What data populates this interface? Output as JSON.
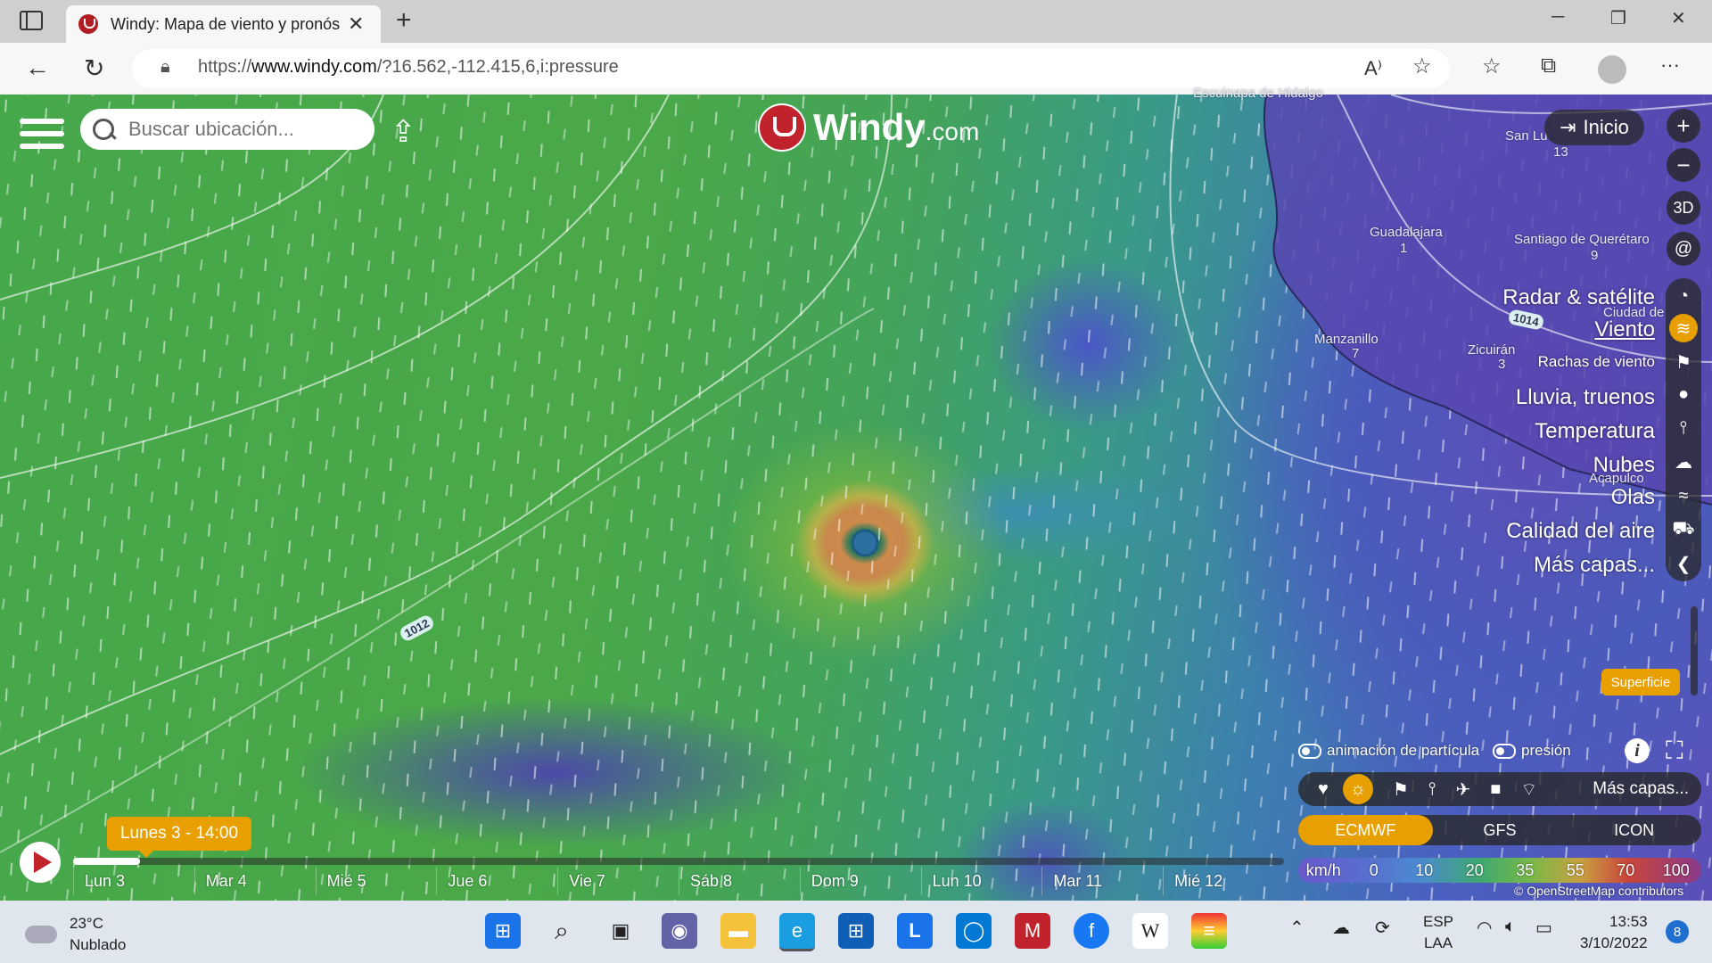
{
  "browser": {
    "tab_title": "Windy: Mapa de viento y pronós",
    "url_prefix": "https://",
    "url_host": "www.windy.com",
    "url_path": "/?16.562,-112.415,6,i:pressure"
  },
  "map": {
    "search_placeholder": "Buscar ubicación...",
    "logo_word": "Windy",
    "logo_suffix": ".com",
    "home_button": "Inicio",
    "btn_3d": "3D",
    "cities": [
      {
        "name": "Guadalajara",
        "num": "1"
      },
      {
        "name": "Santiago de Querétaro",
        "num": "9"
      },
      {
        "name": "San Lu",
        "num": "13"
      },
      {
        "name": "Manzanillo",
        "num": "7"
      },
      {
        "name": "Zicuirán",
        "num": "3"
      },
      {
        "name": "Ciudad de",
        "num": ""
      },
      {
        "name": "Acapulco",
        "num": ""
      },
      {
        "name": "Escuinapa de Hidalgo",
        "num": ""
      }
    ],
    "isobars": [
      "1014",
      "1012"
    ],
    "layers": [
      {
        "label": "Radar & satélite",
        "icon": "radar-icon"
      },
      {
        "label": "Viento",
        "icon": "wind-icon",
        "selected": true
      },
      {
        "label": "Rachas de viento",
        "icon": "gust-flag-icon"
      },
      {
        "label": "Lluvia, truenos",
        "icon": "rain-drop-icon"
      },
      {
        "label": "Temperatura",
        "icon": "thermometer-icon"
      },
      {
        "label": "Nubes",
        "icon": "cloud-icon"
      },
      {
        "label": "Olas",
        "icon": "waves-icon"
      },
      {
        "label": "Calidad del aire",
        "icon": "car-icon"
      },
      {
        "label": "Más capas...",
        "icon": "chevron-left-icon"
      }
    ],
    "altitude": "Superficie",
    "toggles": {
      "particles": "animación de partícula",
      "pressure": "presión"
    },
    "quick_more": "Más capas...",
    "models": [
      "ECMWF",
      "GFS",
      "ICON"
    ],
    "selected_model": "ECMWF",
    "legend_unit": "km/h",
    "legend_values": [
      "0",
      "10",
      "20",
      "35",
      "55",
      "70",
      "100"
    ],
    "attribution": "© OpenStreetMap contributors",
    "timeline": {
      "current": "Lunes 3 - 14:00",
      "progress": 0.055,
      "days": [
        "Lun 3",
        "Mar 4",
        "Mié 5",
        "Jue 6",
        "Vie 7",
        "Sáb 8",
        "Dom 9",
        "Lun 10",
        "Mar 11",
        "Mié 12"
      ]
    }
  },
  "taskbar": {
    "temp": "23°C",
    "condition": "Nublado",
    "lang1": "ESP",
    "lang2": "LAA",
    "time": "13:53",
    "date": "3/10/2022",
    "notifications": "8"
  }
}
